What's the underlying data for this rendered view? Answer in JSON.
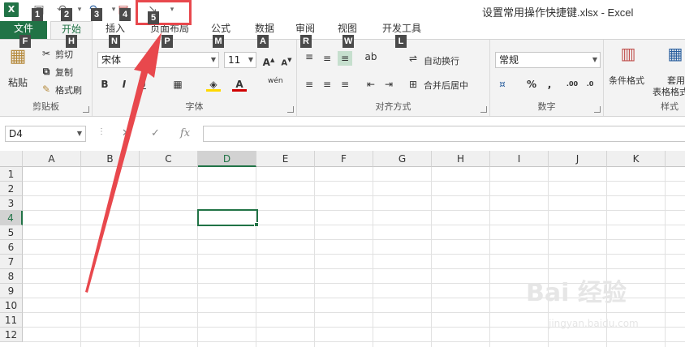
{
  "window": {
    "title": "设置常用操作快捷键.xlsx - Excel"
  },
  "qat": {
    "app_icon_glyph": "X",
    "keytips": [
      "1",
      "2",
      "3",
      "4",
      "5"
    ]
  },
  "tabs": [
    {
      "label": "文件",
      "keytip": "F"
    },
    {
      "label": "开始",
      "keytip": "H"
    },
    {
      "label": "插入",
      "keytip": "N"
    },
    {
      "label": "页面布局",
      "keytip": "P"
    },
    {
      "label": "公式",
      "keytip": "M"
    },
    {
      "label": "数据",
      "keytip": "A"
    },
    {
      "label": "审阅",
      "keytip": "R"
    },
    {
      "label": "视图",
      "keytip": "W"
    },
    {
      "label": "开发工具",
      "keytip": "L"
    }
  ],
  "ribbon": {
    "clipboard": {
      "label": "剪贴板",
      "paste": "粘贴",
      "cut": "剪切",
      "copy": "复制",
      "format_painter": "格式刷"
    },
    "font": {
      "label": "字体",
      "font_name": "宋体",
      "font_size": "11",
      "wen": "wén"
    },
    "alignment": {
      "label": "对齐方式",
      "wrap_text": "自动换行",
      "merge_center": "合并后居中"
    },
    "number": {
      "label": "数字",
      "format": "常规"
    },
    "styles": {
      "label": "样式",
      "conditional": "条件格式",
      "table1": "套用",
      "table2": "表格格式"
    }
  },
  "formula_bar": {
    "name_box": "D4",
    "fx": "fx",
    "formula": ""
  },
  "grid": {
    "columns": [
      "A",
      "B",
      "C",
      "D",
      "E",
      "F",
      "G",
      "H",
      "I",
      "J",
      "K"
    ],
    "rows": [
      "1",
      "2",
      "3",
      "4",
      "5",
      "6",
      "7",
      "8",
      "9",
      "10",
      "11",
      "12"
    ],
    "selected_cell": "D4"
  },
  "watermark": {
    "text": "Bai 经验",
    "sub": "jingyan.baidu.com"
  },
  "colors": {
    "excel_green": "#217346",
    "highlight_red": "#e8484d"
  }
}
